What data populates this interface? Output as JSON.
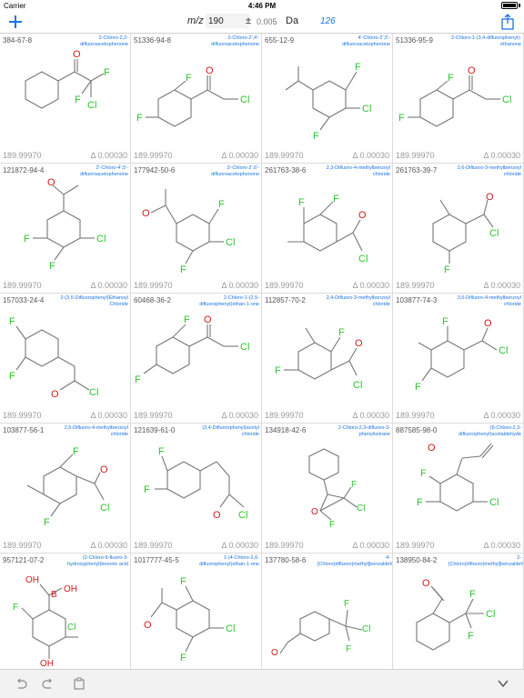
{
  "status": {
    "carrier": "Carrier",
    "time": "4:46 PM"
  },
  "toolbar": {
    "mz_label": "m/z",
    "mz_value": "190",
    "pm": "±",
    "tol_placeholder": "0.005",
    "unit": "Da",
    "count": "126"
  },
  "colors": {
    "accent": "#1a73e8",
    "halogen": "#2ec42e",
    "oxygen": "#d11a1a",
    "bond": "#777777"
  },
  "results": [
    {
      "cas": "384-67-8",
      "name": "2-Chloro-2,2-difluoroacetophenone",
      "mass": "189.99970",
      "delta": "Δ 0.00030"
    },
    {
      "cas": "51336-94-8",
      "name": "2-Chloro-2',4'-difluoroacetophenone",
      "mass": "189.99970",
      "delta": "Δ 0.00030"
    },
    {
      "cas": "655-12-9",
      "name": "4'-Chloro-2',5'-difluoroacetophenone",
      "mass": "189.99970",
      "delta": "Δ 0.00030"
    },
    {
      "cas": "51336-95-9",
      "name": "2-Chloro-1-(3,4-difluorophenyl)-ethanone",
      "mass": "189.99970",
      "delta": "Δ 0.00030"
    },
    {
      "cas": "121872-94-4",
      "name": "2'-Chloro-4',5'-difluoroacetophenone",
      "mass": "189.99970",
      "delta": "Δ 0.00030"
    },
    {
      "cas": "177942-50-6",
      "name": "3'-Chloro-2',6'-difluoroacetophenone",
      "mass": "189.99970",
      "delta": "Δ 0.00030"
    },
    {
      "cas": "261763-38-6",
      "name": "2,3-Difluoro-4-methylbenzoyl chloride",
      "mass": "189.99970",
      "delta": "Δ 0.00030"
    },
    {
      "cas": "261763-39-7",
      "name": "2,6-Difluoro-3-methylbenzoyl chloride",
      "mass": "189.99970",
      "delta": "Δ 0.00030"
    },
    {
      "cas": "157033-24-4",
      "name": "2-(3,5-Difluorophenyl)Ethanoyl Chloride",
      "mass": "189.99970",
      "delta": "Δ 0.00030"
    },
    {
      "cas": "60468-36-2",
      "name": "2-Chloro-1-(2,5-difluorophenyl)ethan-1-one",
      "mass": "189.99970",
      "delta": "Δ 0.00030"
    },
    {
      "cas": "112857-70-2",
      "name": "2,4-Difluoro-3-methylbenzoyl chloride",
      "mass": "189.99970",
      "delta": "Δ 0.00030"
    },
    {
      "cas": "103877-74-3",
      "name": "3,5-Difluoro-4-methylbenzoyl chloride",
      "mass": "189.99970",
      "delta": "Δ 0.00030"
    },
    {
      "cas": "103877-56-1",
      "name": "2,5-Difluoro-4-methylbenzoyl chloride",
      "mass": "189.99970",
      "delta": "Δ 0.00030"
    },
    {
      "cas": "121639-61-0",
      "name": "(3,4-Difluorophenyl)acetyl chloride",
      "mass": "189.99970",
      "delta": "Δ 0.00030"
    },
    {
      "cas": "134918-42-6",
      "name": "2-Chloro-2,3-difluoro-3-phenyloxirane",
      "mass": "189.99970",
      "delta": "Δ 0.00030"
    },
    {
      "cas": "887585-98-0",
      "name": "(6-Chloro-2,3-difluorophenyl)acetaldehyde",
      "mass": "189.99970",
      "delta": "Δ 0.00030"
    },
    {
      "cas": "957121-07-2",
      "name": "(2-Chloro-6-fluoro-3-hydroxyphenyl)boronic acid",
      "mass": "",
      "delta": ""
    },
    {
      "cas": "1017777-45-5",
      "name": "1-(4-Chloro-2,6-difluorophenyl)ethan-1-one",
      "mass": "",
      "delta": ""
    },
    {
      "cas": "137780-58-6",
      "name": "4-[Chloro(difluoro)methyl]benzaldehyde",
      "mass": "",
      "delta": ""
    },
    {
      "cas": "138950-84-2",
      "name": "2-[Chloro(difluoro)methyl]benzaldehyde",
      "mass": "",
      "delta": ""
    }
  ],
  "atoms": {
    "F": "F",
    "Cl": "Cl",
    "O": "O",
    "OH": "OH",
    "B": "B"
  }
}
